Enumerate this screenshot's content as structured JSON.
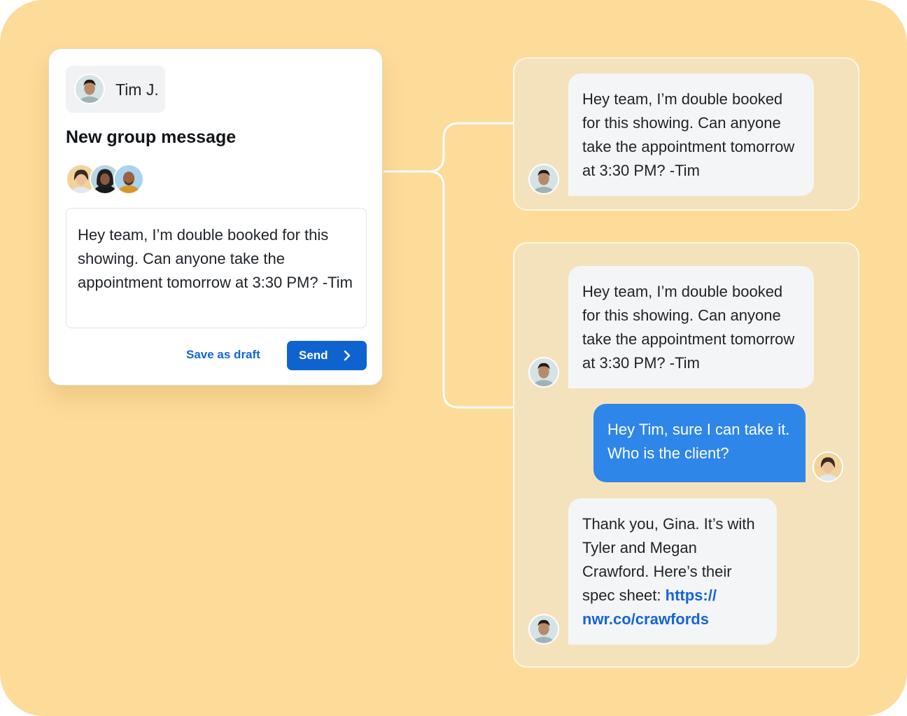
{
  "compose": {
    "sender_name": "Tim J.",
    "title": "New group message",
    "message": "Hey team, I’m double booked for this showing. Can anyone take the appointment tomorrow at 3:30 PM? -Tim",
    "save_draft_label": "Save as draft",
    "send_label": "Send",
    "recipient_count": 3
  },
  "thread_1": {
    "messages": [
      {
        "text": "Hey team, I’m double booked for this showing. Can anyone take the appointment tomorrow at 3:30 PM? -Tim"
      }
    ]
  },
  "thread_2": {
    "messages": [
      {
        "text": "Hey team, I’m double booked for this showing. Can anyone take the appointment tomorrow at 3:30 PM? -Tim"
      },
      {
        "text": "Hey Tim, sure I can take it. Who is the client?"
      },
      {
        "text": "Thank you, Gina. It’s with Tyler and Megan Crawford. Here’s their spec sheet: ",
        "link": "https://\nnwr.co/crawfords"
      }
    ]
  },
  "colors": {
    "background": "#fddb99",
    "panel": "#f4e2bd",
    "accent_blue": "#0f63cf",
    "outgoing_bubble": "#2e86e8",
    "link": "#1366d6"
  }
}
